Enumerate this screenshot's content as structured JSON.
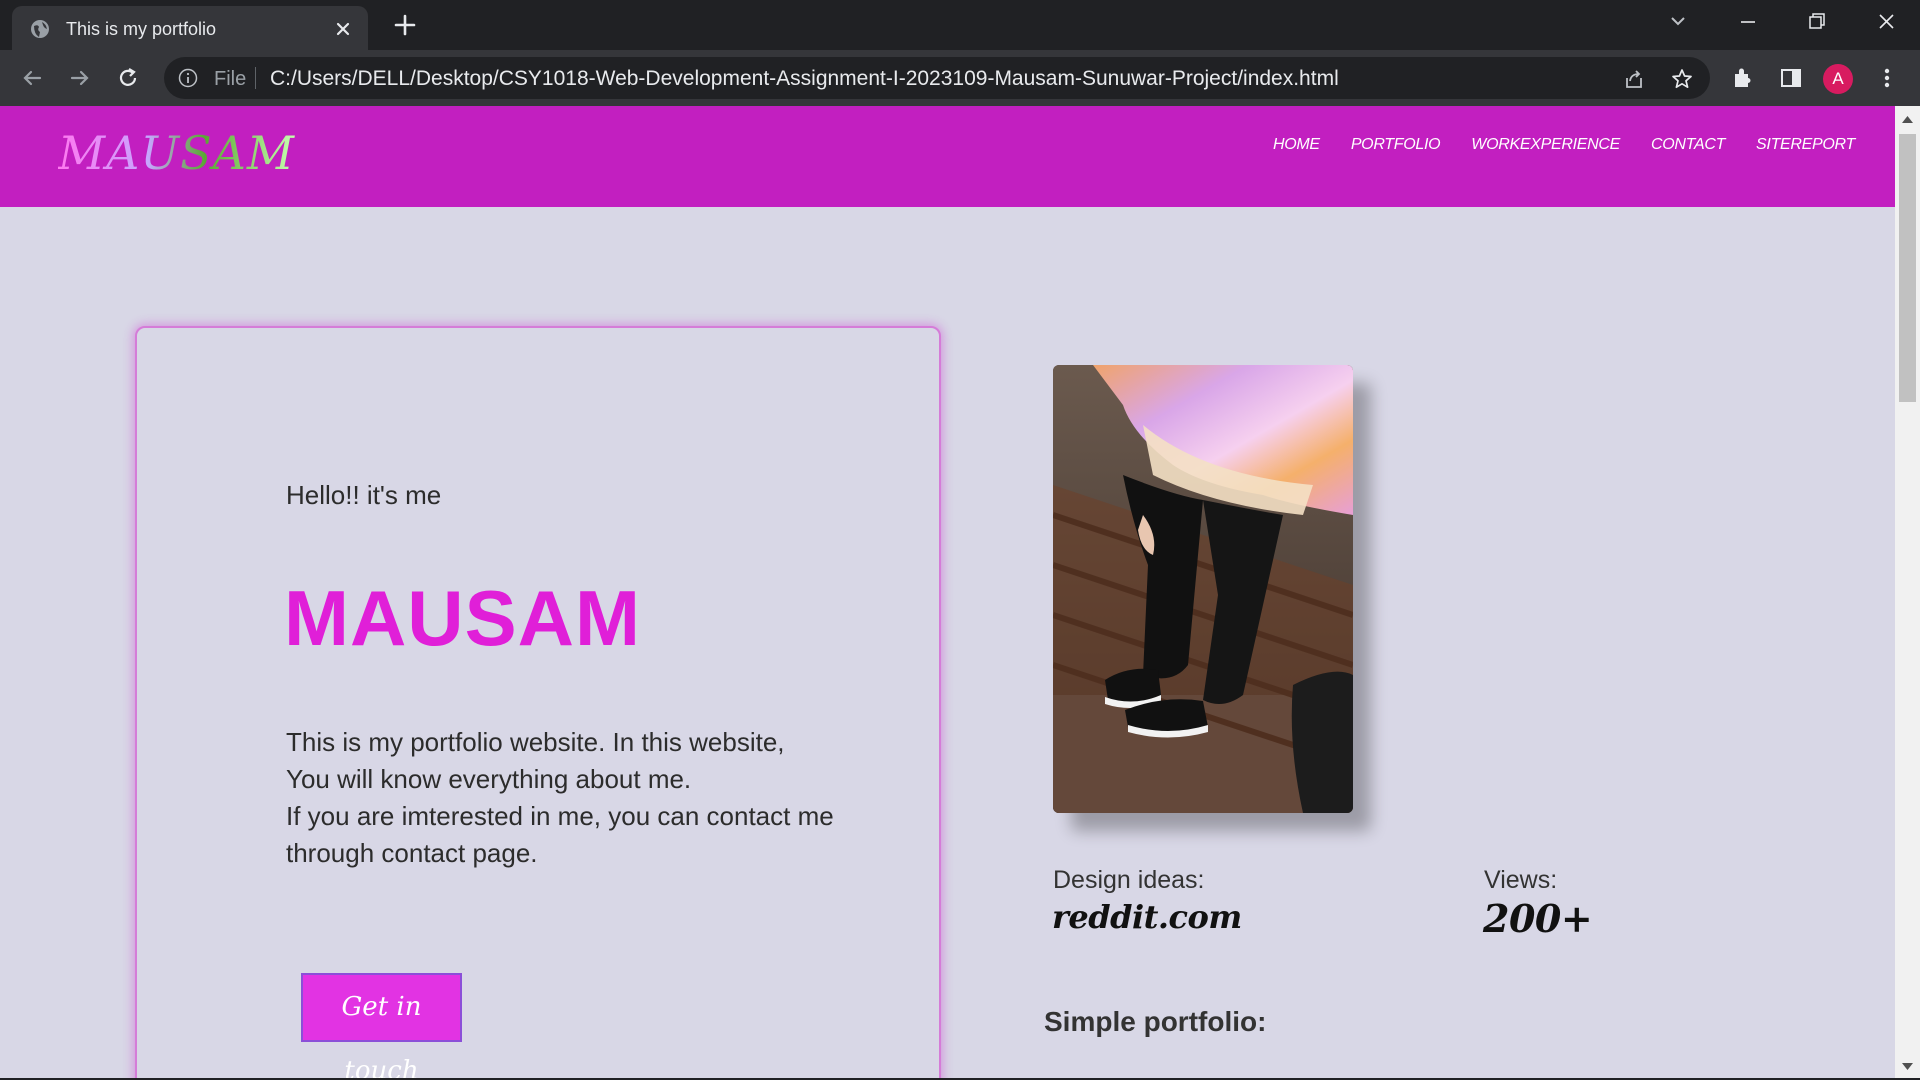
{
  "browser": {
    "tab_title": "This is my portfolio",
    "file_label": "File",
    "url": "C:/Users/DELL/Desktop/CSY1018-Web-Development-Assignment-I-2023109-Mausam-Sunuwar-Project/index.html",
    "profile_initial": "A",
    "profile_color": "#d81b60"
  },
  "site": {
    "logo": "MAUSAM",
    "accent_color": "#c21fc0",
    "nav": [
      "HOME",
      "PORTFOLIO",
      "WORKEXPERIENCE",
      "CONTACT",
      "SITEREPORT"
    ]
  },
  "hero": {
    "greeting": "Hello!! it's me",
    "name": "MAUSAM",
    "description": [
      "This is my portfolio website. In this website,",
      "You will know everything about me.",
      "If you are imterested in me, you can contact me",
      "through contact page."
    ],
    "cta_label": "Get in touch"
  },
  "stats": {
    "design_label": "Design ideas:",
    "design_value": "reddit.com",
    "views_label": "Views:",
    "views_value": "200+"
  },
  "section": {
    "title": "Simple portfolio:"
  }
}
